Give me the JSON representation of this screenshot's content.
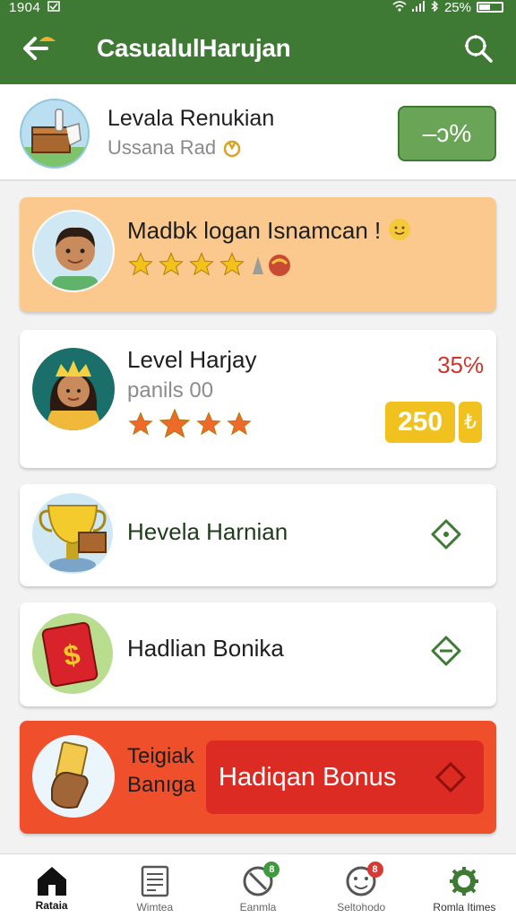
{
  "status_bar": {
    "time": "1904",
    "battery": "25%"
  },
  "app_bar": {
    "title": "CasualulHarujan"
  },
  "summary": {
    "title": "Levala Renukian",
    "subtitle": "Ussana Rad",
    "pill": "‒ɔ%"
  },
  "cards": [
    {
      "title": "Madbk logan Isnamcan !",
      "rating": 4
    },
    {
      "title": "Level Harjay",
      "subtitle": "panils 00",
      "badge": "35℅",
      "coin_value": "250",
      "coin_side": "₺",
      "rating": 4
    },
    {
      "title": "Hevela Harnian"
    },
    {
      "title": "Hadlian Bonika"
    },
    {
      "label_line1": "Teigiak",
      "label_line2": "Banıga",
      "button": "Hadiqan Bonus"
    }
  ],
  "bottom_nav": [
    {
      "label": "Rataia",
      "icon": "home-icon"
    },
    {
      "label": "Wimtea",
      "icon": "document-icon"
    },
    {
      "label": "Eanmla",
      "icon": "no-entry-icon",
      "badge": "8"
    },
    {
      "label": "Seltohodo",
      "icon": "smile-icon",
      "badge": "8"
    },
    {
      "label": "Romla Itimes",
      "icon": "gear-icon"
    }
  ],
  "colors": {
    "primary": "#3f7a35",
    "orange_card": "#fbc98d",
    "bonus_red": "#ef4f2a",
    "coin": "#f1c21f"
  }
}
